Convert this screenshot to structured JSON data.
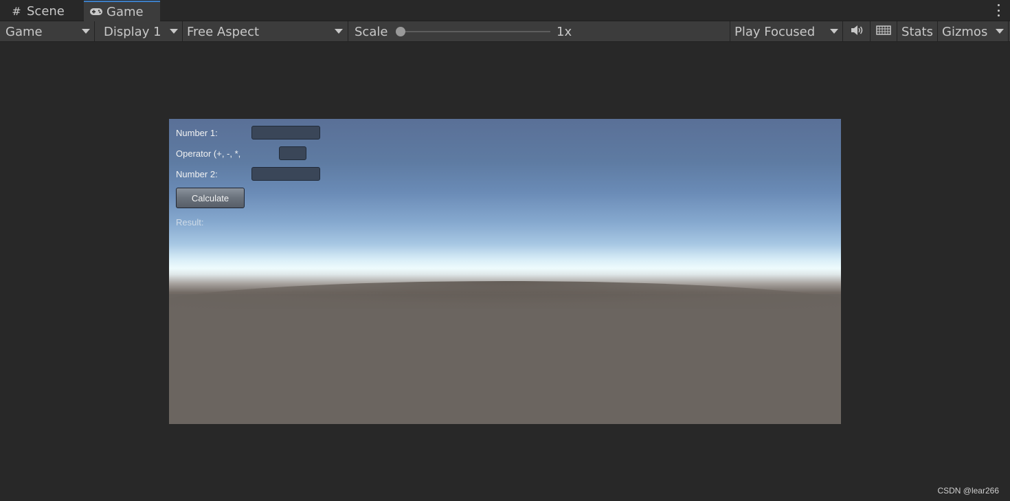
{
  "tabs": [
    {
      "label": "Scene",
      "icon": "hash-icon"
    },
    {
      "label": "Game",
      "icon": "gamepad-icon"
    }
  ],
  "toolbar": {
    "view_dropdown": "Game",
    "display_dropdown": "Display 1",
    "aspect_dropdown": "Free Aspect",
    "scale_label": "Scale",
    "scale_value": "1x",
    "play_mode_dropdown": "Play Focused",
    "stats_label": "Stats",
    "gizmos_label": "Gizmos"
  },
  "calculator": {
    "number1_label": "Number 1:",
    "number1_value": "",
    "operator_label": "Operator (+, -, *,",
    "operator_value": "",
    "number2_label": "Number 2:",
    "number2_value": "",
    "calculate_button": "Calculate",
    "result_label": "Result:"
  },
  "watermark": "CSDN @lear266",
  "colors": {
    "active_tab_accent": "#3d7fc7",
    "toolbar_bg": "#3c3c3c",
    "editor_bg": "#282828"
  }
}
